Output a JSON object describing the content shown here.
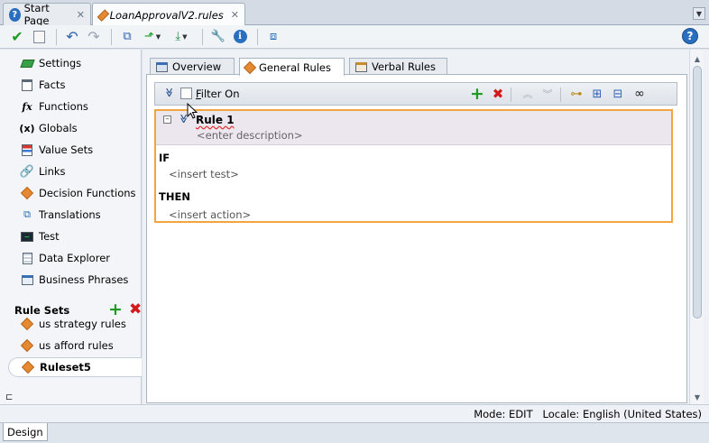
{
  "doc_tabs": [
    {
      "label": "Start Page",
      "icon": "help-circle-icon",
      "active": false
    },
    {
      "label": "LoanApprovalV2.rules",
      "icon": "rules-diamond-icon",
      "active": true
    }
  ],
  "close_glyph": "✕",
  "toolbar": {
    "buttons": [
      "validate-check-icon",
      "generate-report-icon",
      "undo-icon",
      "redo-icon",
      "flow-icon",
      "up-arrow-dropdown-icon",
      "export-dropdown-icon",
      "wrench-icon",
      "info-icon",
      "test-run-icon"
    ],
    "help_label": "?"
  },
  "navigator": {
    "items": [
      {
        "label": "Settings",
        "icon": "settings-book-icon"
      },
      {
        "label": "Facts",
        "icon": "facts-icon"
      },
      {
        "label": "Functions",
        "icon": "function-fx-icon"
      },
      {
        "label": "Globals",
        "icon": "globals-x-icon"
      },
      {
        "label": "Value Sets",
        "icon": "value-sets-icon"
      },
      {
        "label": "Links",
        "icon": "link-icon"
      },
      {
        "label": "Decision Functions",
        "icon": "decision-function-icon"
      },
      {
        "label": "Translations",
        "icon": "translations-icon"
      },
      {
        "label": "Test",
        "icon": "test-monitor-icon"
      },
      {
        "label": "Data Explorer",
        "icon": "data-explorer-icon"
      },
      {
        "label": "Business Phrases",
        "icon": "business-phrases-icon"
      }
    ],
    "rule_sets_label": "Rule Sets",
    "rule_sets": [
      {
        "label": "us strategy rules",
        "selected": false
      },
      {
        "label": "us afford rules",
        "selected": false
      },
      {
        "label": "Ruleset5",
        "selected": true
      }
    ],
    "bottom_glyph": "⊏"
  },
  "editor_tabs": [
    {
      "label": "Overview",
      "icon": "overview-icon"
    },
    {
      "label": "General Rules",
      "icon": "general-rules-diamond-icon",
      "active": true
    },
    {
      "label": "Verbal Rules",
      "icon": "verbal-rules-icon"
    }
  ],
  "rule_toolbar": {
    "filter_label": "Filter On",
    "collapse_glyph": "≫"
  },
  "rule": {
    "name": "Rule 1",
    "description": "<enter description>",
    "if_label": "IF",
    "test_placeholder": "<insert test>",
    "then_label": "THEN",
    "action_placeholder": "<insert action>"
  },
  "status": {
    "text": "Mode: EDIT   Locale: English (United States)"
  },
  "bottom_tab": "Design",
  "colors": {
    "accent_orange": "#f3a43a",
    "add_green": "#1d9b22",
    "delete_red": "#d21a1a"
  }
}
